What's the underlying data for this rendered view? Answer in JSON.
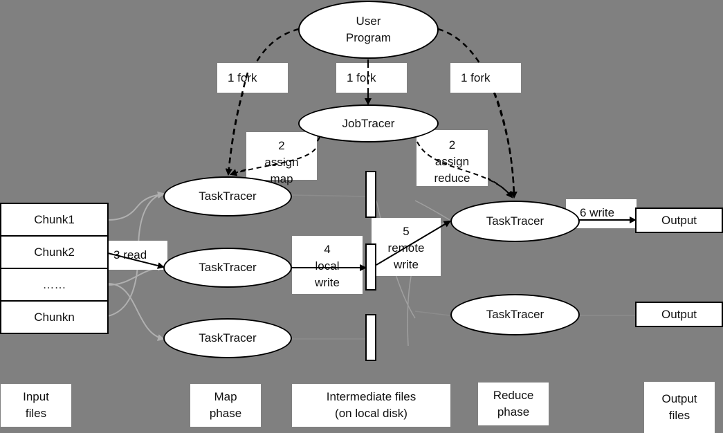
{
  "colors": {
    "background": "#808080",
    "node_fill": "#ffffff",
    "stroke": "#000000",
    "faint_line": "#b0b0b0"
  },
  "nodes": {
    "user_program": "User\nProgram",
    "job_tracer": "JobTracer",
    "map_tasks": [
      "TaskTracer",
      "TaskTracer",
      "TaskTracer"
    ],
    "reduce_tasks": [
      "TaskTracer",
      "TaskTracer"
    ]
  },
  "input_chunks": [
    "Chunk1",
    "Chunk2",
    "……",
    "Chunkn"
  ],
  "outputs": [
    "Output",
    "Output"
  ],
  "edge_labels": {
    "fork_left": "1 fork",
    "fork_center": "1 fork",
    "fork_right": "1 fork",
    "assign_map": "2\nassign\nmap",
    "assign_reduce": "2\nassign\nreduce",
    "read": "3 read",
    "local_write": "4\nlocal\nwrite",
    "remote_write": "5\nremote\nwrite",
    "write": "6 write"
  },
  "phases": [
    "Input\nfiles",
    "Map\nphase",
    "Intermediate files\n(on local disk)",
    "Reduce\nphase",
    "Output\nfiles"
  ]
}
